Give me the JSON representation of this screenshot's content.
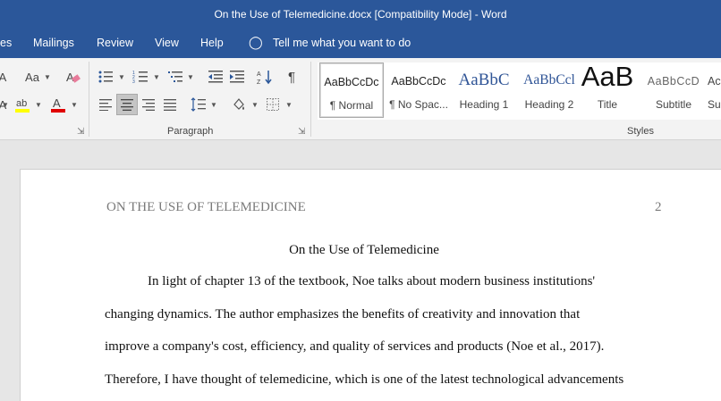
{
  "window": {
    "title": "On the Use of Telemedicine.docx [Compatibility Mode]  -  Word"
  },
  "menu": {
    "items": [
      "es",
      "Mailings",
      "Review",
      "View",
      "Help"
    ],
    "tell_me": "Tell me what you want to do"
  },
  "ribbon": {
    "font_group": {
      "change_case": "Aa",
      "clear_format": "A"
    },
    "paragraph_label": "Paragraph",
    "styles_label": "Styles",
    "styles": [
      {
        "preview": "AaBbCcDc",
        "name": "¶ Normal"
      },
      {
        "preview": "AaBbCcDc",
        "name": "¶ No Spac..."
      },
      {
        "preview": "AaBbC",
        "name": "Heading 1"
      },
      {
        "preview": "AaBbCcl",
        "name": "Heading 2"
      },
      {
        "preview": "AaB",
        "name": "Title"
      },
      {
        "preview": "AaBbCcD",
        "name": "Subtitle"
      },
      {
        "preview": "Ac",
        "name": "Su"
      }
    ],
    "colors": {
      "highlight": "#ffff00",
      "font_color": "#e00000",
      "accent": "#2b579a"
    }
  },
  "document": {
    "running_head": "ON THE USE OF TELEMEDICINE",
    "page_number": "2",
    "title": "On the Use of Telemedicine",
    "lines": [
      "In light of chapter 13 of the textbook, Noe talks about modern business institutions'",
      "changing dynamics. The author emphasizes the benefits of creativity and innovation that",
      "improve a company's cost, efficiency, and quality of services and products (Noe et al., 2017).",
      "Therefore, I have thought of telemedicine, which is one of the latest technological advancements"
    ]
  }
}
